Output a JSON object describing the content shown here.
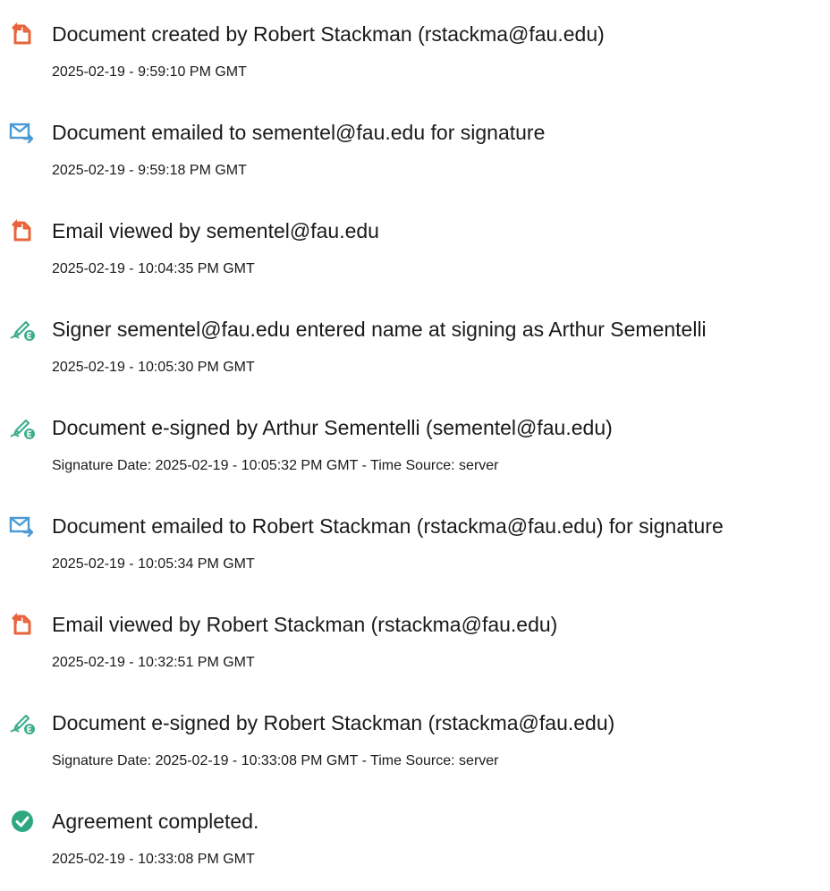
{
  "colors": {
    "document_icon": "#e8643c",
    "email_icon": "#4a9ad6",
    "sign_icon": "#3fae8c",
    "complete_icon": "#2fa881"
  },
  "events": [
    {
      "icon": "document-icon",
      "title": "Document created by Robert Stackman (rstackma@fau.edu)",
      "timestamp": "2025-02-19 - 9:59:10 PM GMT"
    },
    {
      "icon": "email-send-icon",
      "title": "Document emailed to sementel@fau.edu for signature",
      "timestamp": "2025-02-19 - 9:59:18 PM GMT"
    },
    {
      "icon": "document-icon",
      "title": "Email viewed by sementel@fau.edu",
      "timestamp": "2025-02-19 - 10:04:35 PM GMT"
    },
    {
      "icon": "pen-sign-icon",
      "title": "Signer sementel@fau.edu entered name at signing as Arthur Sementelli",
      "timestamp": "2025-02-19 - 10:05:30 PM GMT"
    },
    {
      "icon": "pen-sign-icon",
      "title": "Document e-signed by Arthur Sementelli (sementel@fau.edu)",
      "timestamp": "Signature Date: 2025-02-19 - 10:05:32 PM GMT - Time Source: server"
    },
    {
      "icon": "email-send-icon",
      "title": "Document emailed to Robert Stackman (rstackma@fau.edu) for signature",
      "timestamp": "2025-02-19 - 10:05:34 PM GMT"
    },
    {
      "icon": "document-icon",
      "title": "Email viewed by Robert Stackman (rstackma@fau.edu)",
      "timestamp": "2025-02-19 - 10:32:51 PM GMT"
    },
    {
      "icon": "pen-sign-icon",
      "title": "Document e-signed by Robert Stackman (rstackma@fau.edu)",
      "timestamp": "Signature Date: 2025-02-19 - 10:33:08 PM GMT - Time Source: server"
    },
    {
      "icon": "check-circle-icon",
      "title": "Agreement completed.",
      "timestamp": "2025-02-19 - 10:33:08 PM GMT"
    }
  ]
}
